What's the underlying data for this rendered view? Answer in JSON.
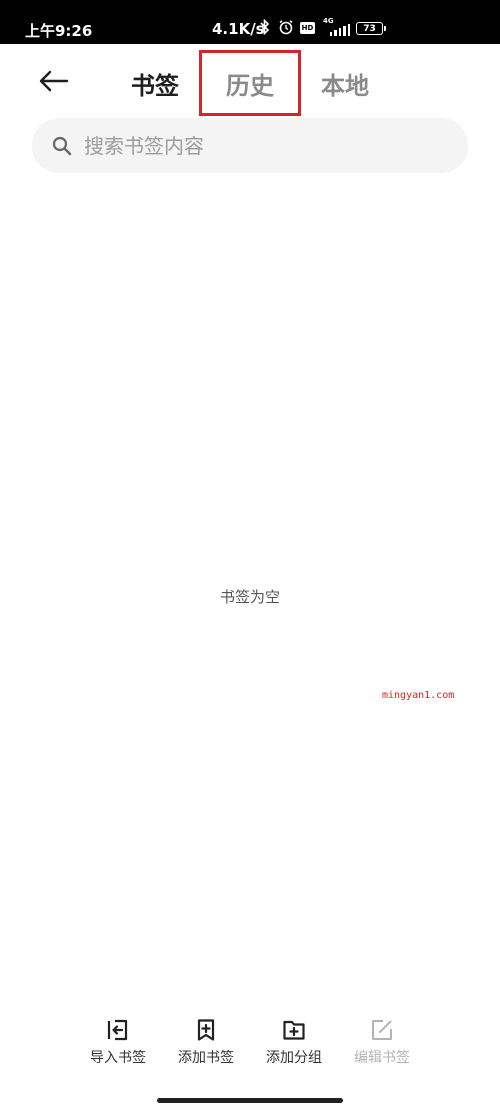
{
  "status_bar": {
    "time": "上午9:26",
    "net_speed": "4.1K/s",
    "hd": "HD",
    "network": "4G",
    "battery": "73"
  },
  "header": {
    "tabs": [
      {
        "label": "书签",
        "active": true
      },
      {
        "label": "历史",
        "active": false
      },
      {
        "label": "本地",
        "active": false
      }
    ],
    "highlight_color": "#d7232a"
  },
  "search": {
    "placeholder": "搜索书签内容",
    "value": ""
  },
  "main": {
    "empty_message": "书签为空",
    "watermark": "mingyan1.com"
  },
  "toolbar": {
    "items": [
      {
        "label": "导入书签",
        "icon": "import-icon",
        "enabled": true
      },
      {
        "label": "添加书签",
        "icon": "add-bookmark-icon",
        "enabled": true
      },
      {
        "label": "添加分组",
        "icon": "add-folder-icon",
        "enabled": true
      },
      {
        "label": "编辑书签",
        "icon": "edit-icon",
        "enabled": false
      }
    ]
  }
}
